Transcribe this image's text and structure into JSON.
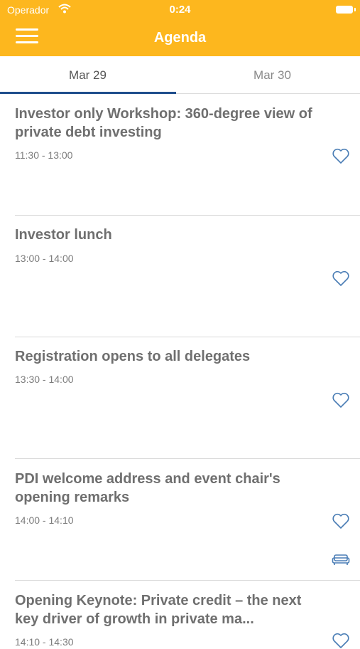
{
  "status": {
    "carrier": "Operador",
    "time": "0:24"
  },
  "header": {
    "title": "Agenda"
  },
  "tabs": [
    {
      "label": "Mar 29"
    },
    {
      "label": "Mar 30"
    }
  ],
  "sessions": [
    {
      "title": "Investor only Workshop: 360-degree view of private debt investing",
      "time": "11:30 - 13:00"
    },
    {
      "title": "Investor lunch",
      "time": "13:00 - 14:00"
    },
    {
      "title": "Registration opens to all delegates",
      "time": "13:30 - 14:00"
    },
    {
      "title": "PDI welcome address and event chair's opening remarks",
      "time": "14:00 - 14:10"
    },
    {
      "title": "Opening Keynote: Private credit – the next key driver of growth in private ma...",
      "time": "14:10 - 14:30"
    }
  ],
  "colors": {
    "header": "#FDB71E",
    "accent": "#1F4E8C",
    "icon": "#4A7DB5"
  }
}
